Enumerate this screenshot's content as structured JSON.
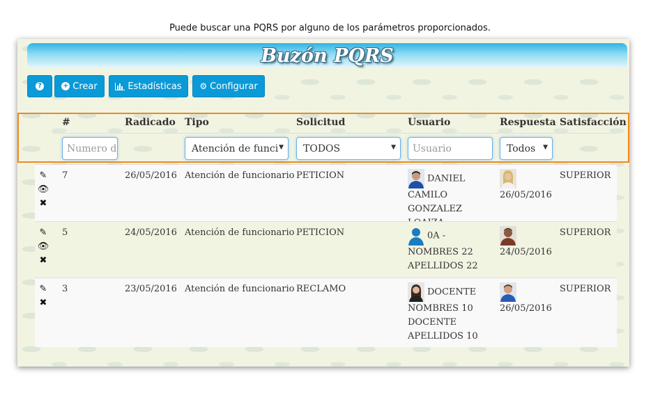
{
  "caption": "Puede buscar una PQRS por alguno de los parámetros proporcionados.",
  "title": "Buzón PQRS",
  "toolbar": {
    "help_label": "?",
    "create_label": "Crear",
    "stats_label": "Estadísticas",
    "config_label": "Configurar"
  },
  "columns": {
    "num": "#",
    "radicado": "Radicado",
    "tipo": "Tipo",
    "solicitud": "Solicitud",
    "usuario": "Usuario",
    "respuesta": "Respuesta",
    "satisfaccion": "Satisfacción"
  },
  "filters": {
    "numero_placeholder": "Numero d",
    "tipo_value": "Atención de funci",
    "solicitud_value": "TODOS",
    "usuario_placeholder": "Usuario",
    "respuesta_value": "Todos"
  },
  "rows": [
    {
      "num": "7",
      "radicado": "26/05/2016",
      "tipo": "Atención de funcionario",
      "solicitud": "PETICION",
      "usuario_l1": "DANIEL",
      "usuario_l2": "CAMILO GONZALEZ",
      "usuario_l3": "LOAIZA",
      "respuesta": "26/05/2016",
      "satisfaccion": "SUPERIOR"
    },
    {
      "num": "5",
      "radicado": "24/05/2016",
      "tipo": "Atención de funcionario",
      "solicitud": "PETICION",
      "usuario_l1": "0A -",
      "usuario_l2": "NOMBRES 22",
      "usuario_l3": "APELLIDOS 22",
      "respuesta": "24/05/2016",
      "satisfaccion": "SUPERIOR"
    },
    {
      "num": "3",
      "radicado": "23/05/2016",
      "tipo": "Atención de funcionario",
      "solicitud": "RECLAMO",
      "usuario_l1": "DOCENTE",
      "usuario_l2": "NOMBRES 10",
      "usuario_l3": "DOCENTE",
      "usuario_l4": "APELLIDOS 10",
      "respuesta": "26/05/2016",
      "satisfaccion": "SUPERIOR"
    }
  ]
}
